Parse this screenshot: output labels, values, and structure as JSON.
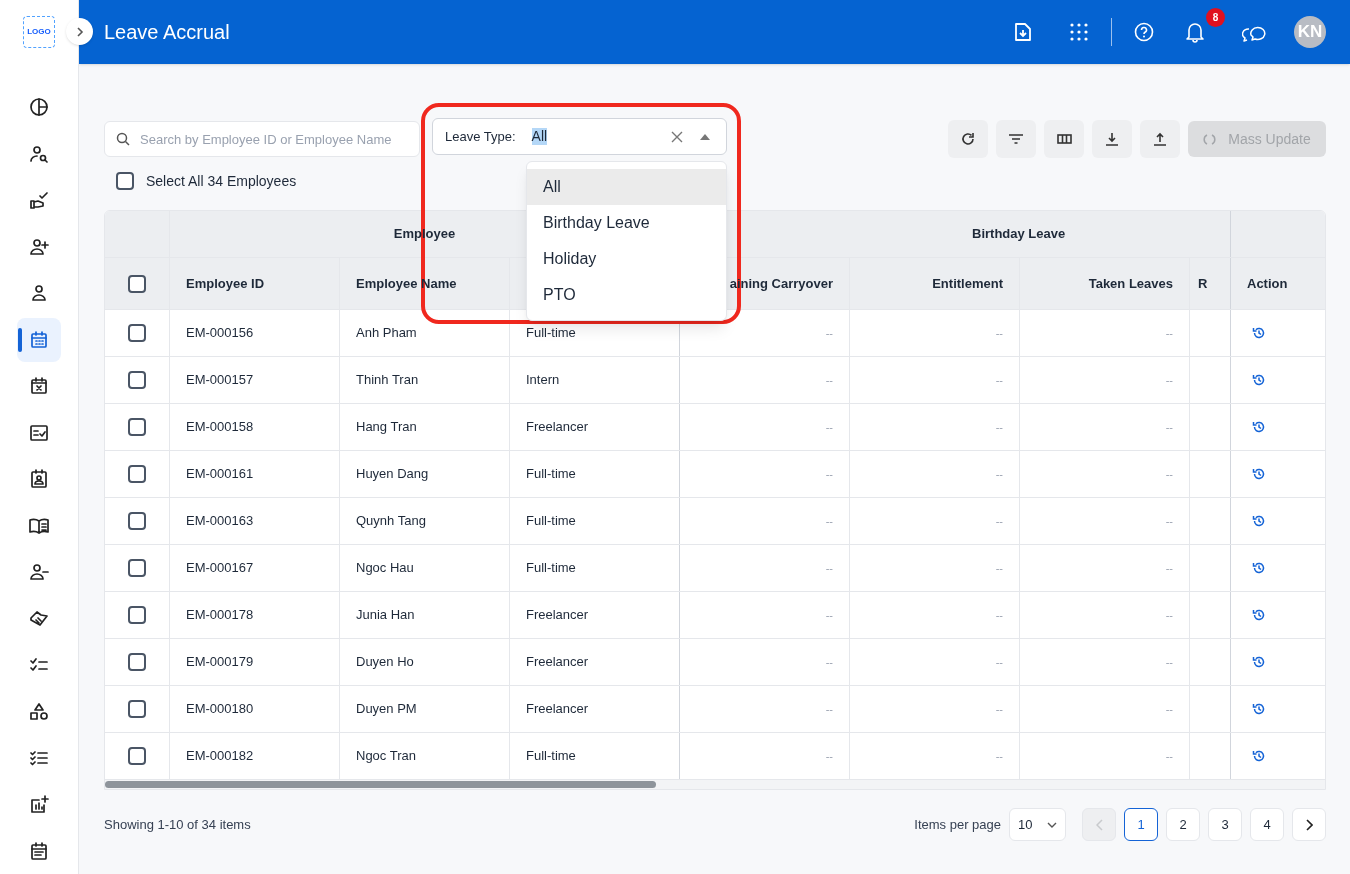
{
  "sidebar": {
    "logo": "LOGO",
    "items": [
      {
        "selected": false
      },
      {
        "selected": false
      },
      {
        "selected": false
      },
      {
        "selected": false
      },
      {
        "selected": false
      },
      {
        "selected": true
      },
      {
        "selected": false
      },
      {
        "selected": false
      },
      {
        "selected": false
      },
      {
        "selected": false
      },
      {
        "selected": false
      },
      {
        "selected": false
      },
      {
        "selected": false
      },
      {
        "selected": false
      },
      {
        "selected": false
      },
      {
        "selected": false
      },
      {
        "selected": false
      }
    ]
  },
  "header": {
    "title": "Leave Accrual",
    "notification_count": "8",
    "avatar": "KN"
  },
  "toolbar": {
    "search_placeholder": "Search by Employee ID or Employee Name",
    "leave_type": {
      "label": "Leave Type:",
      "value": "All",
      "expanded": true,
      "options": [
        {
          "label": "All",
          "selected": true
        },
        {
          "label": "Birthday Leave",
          "selected": false
        },
        {
          "label": "Holiday",
          "selected": false
        },
        {
          "label": "PTO",
          "selected": false
        }
      ]
    },
    "mass_update": {
      "label": "Mass Update",
      "disabled": true
    }
  },
  "select_all": {
    "label": "Select All 34 Employees",
    "checked": false
  },
  "table": {
    "groups": [
      "Employee",
      "Birthday Leave"
    ],
    "columns": [
      "Employee ID",
      "Employee Name",
      "aining Carryover",
      "Entitlement",
      "Taken Leaves",
      "R",
      "Action"
    ],
    "rows": [
      {
        "checked": false,
        "id": "EM-000156",
        "name": "Anh Pham",
        "type": "Full-time",
        "values": [
          "--",
          "--",
          "--"
        ]
      },
      {
        "checked": false,
        "id": "EM-000157",
        "name": "Thinh Tran",
        "type": "Intern",
        "values": [
          "--",
          "--",
          "--"
        ]
      },
      {
        "checked": false,
        "id": "EM-000158",
        "name": "Hang Tran",
        "type": "Freelancer",
        "values": [
          "--",
          "--",
          "--"
        ]
      },
      {
        "checked": false,
        "id": "EM-000161",
        "name": "Huyen Dang",
        "type": "Full-time",
        "values": [
          "--",
          "--",
          "--"
        ]
      },
      {
        "checked": false,
        "id": "EM-000163",
        "name": "Quynh Tang",
        "type": "Full-time",
        "values": [
          "--",
          "--",
          "--"
        ]
      },
      {
        "checked": false,
        "id": "EM-000167",
        "name": "Ngoc Hau",
        "type": "Full-time",
        "values": [
          "--",
          "--",
          "--"
        ]
      },
      {
        "checked": false,
        "id": "EM-000178",
        "name": "Junia Han",
        "type": "Freelancer",
        "values": [
          "--",
          "--",
          "--"
        ]
      },
      {
        "checked": false,
        "id": "EM-000179",
        "name": "Duyen Ho",
        "type": "Freelancer",
        "values": [
          "--",
          "--",
          "--"
        ]
      },
      {
        "checked": false,
        "id": "EM-000180",
        "name": "Duyen PM",
        "type": "Freelancer",
        "values": [
          "--",
          "--",
          "--"
        ]
      },
      {
        "checked": false,
        "id": "EM-000182",
        "name": "Ngoc Tran",
        "type": "Full-time",
        "values": [
          "--",
          "--",
          "--"
        ]
      }
    ]
  },
  "footer": {
    "summary": "Showing 1-10 of 34 items",
    "items_per_page_label": "Items per page",
    "items_per_page": "10",
    "prev_disabled": true,
    "pages": [
      {
        "label": "1",
        "selected": true
      },
      {
        "label": "2",
        "selected": false
      },
      {
        "label": "3",
        "selected": false
      },
      {
        "label": "4",
        "selected": false
      }
    ]
  }
}
